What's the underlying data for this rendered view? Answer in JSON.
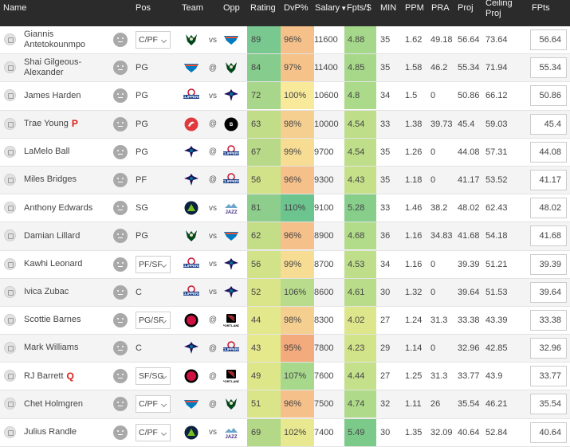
{
  "header": {
    "name": "Name",
    "pos": "Pos",
    "team": "Team",
    "opp": "Opp",
    "rating": "Rating",
    "dvp": "DvP%",
    "salary": "Salary",
    "fpts_per": "Fpts/$",
    "min": "MIN",
    "ppm": "PPM",
    "pra": "PRA",
    "proj": "Proj",
    "ceiling": "Ceiling Proj",
    "fpts": "FPts"
  },
  "teams": {
    "MIL": {
      "icon": "bucks-logo-icon",
      "color": "#00471B",
      "text": ""
    },
    "OKC": {
      "icon": "thunder-logo-icon",
      "color": "#007AC1",
      "text": ""
    },
    "LAC": {
      "icon": "clippers-logo-icon",
      "color": "#C8102E",
      "text": "CLIPPERS"
    },
    "CHA": {
      "icon": "hornets-logo-icon",
      "color": "#1D1160",
      "text": ""
    },
    "BKN": {
      "icon": "nets-logo-icon",
      "color": "#000000",
      "text": "BROOKLYN"
    },
    "ATL": {
      "icon": "hawks-logo-icon",
      "color": "#E03A3E",
      "text": ""
    },
    "MIN": {
      "icon": "timberwolves-logo-icon",
      "color": "#0C2340",
      "text": ""
    },
    "UTA": {
      "icon": "jazz-logo-icon",
      "color": "#3E2680",
      "text": "JAZZ"
    },
    "TOR": {
      "icon": "raptors-logo-icon",
      "color": "#CE1141",
      "text": ""
    },
    "POR": {
      "icon": "blazers-logo-icon",
      "color": "#E03A3E",
      "text": "PORTLAND"
    }
  },
  "players": [
    {
      "name": "Giannis Antetokounmpo",
      "tag": "",
      "pos": "C/PF",
      "pos_select": true,
      "team": "MIL",
      "ha": "vs",
      "opp": "OKC",
      "rating": "89",
      "dvp": "96%",
      "salary": "11600",
      "fpts_per": "4.88",
      "min": "35",
      "ppm": "1.62",
      "pra": "49.18",
      "proj": "56.64",
      "ceil": "73.64",
      "fpts": "56.64",
      "rating_color": "#78c890",
      "dvp_color": "#f5c08a",
      "fpts_color": "#a5d88a"
    },
    {
      "name": "Shai Gilgeous-Alexander",
      "tag": "",
      "pos": "PG",
      "pos_select": false,
      "team": "OKC",
      "ha": "@",
      "opp": "MIL",
      "rating": "84",
      "dvp": "97%",
      "salary": "11400",
      "fpts_per": "4.85",
      "min": "35",
      "ppm": "1.58",
      "pra": "46.2",
      "proj": "55.34",
      "ceil": "71.94",
      "fpts": "55.34",
      "rating_color": "#86cc8c",
      "dvp_color": "#f5c38a",
      "fpts_color": "#a7d88a"
    },
    {
      "name": "James Harden",
      "tag": "",
      "pos": "PG",
      "pos_select": false,
      "team": "LAC",
      "ha": "vs",
      "opp": "CHA",
      "rating": "72",
      "dvp": "100%",
      "salary": "10600",
      "fpts_per": "4.8",
      "min": "34",
      "ppm": "1.5",
      "pra": "0",
      "proj": "50.86",
      "ceil": "66.12",
      "fpts": "50.86",
      "rating_color": "#a8d68a",
      "dvp_color": "#f8ea9a",
      "fpts_color": "#aada8a"
    },
    {
      "name": "Trae Young",
      "tag": "P",
      "pos": "PG",
      "pos_select": false,
      "team": "ATL",
      "ha": "@",
      "opp": "BKN",
      "rating": "63",
      "dvp": "98%",
      "salary": "10000",
      "fpts_per": "4.54",
      "min": "33",
      "ppm": "1.38",
      "pra": "39.73",
      "proj": "45.4",
      "ceil": "59.03",
      "fpts": "45.4",
      "rating_color": "#c2dd88",
      "dvp_color": "#f5cf90",
      "fpts_color": "#bede8a"
    },
    {
      "name": "LaMelo Ball",
      "tag": "",
      "pos": "PG",
      "pos_select": false,
      "team": "CHA",
      "ha": "@",
      "opp": "LAC",
      "rating": "67",
      "dvp": "99%",
      "salary": "9700",
      "fpts_per": "4.54",
      "min": "35",
      "ppm": "1.26",
      "pra": "0",
      "proj": "44.08",
      "ceil": "57.31",
      "fpts": "44.08",
      "rating_color": "#b8da88",
      "dvp_color": "#f7dc94",
      "fpts_color": "#bede8a"
    },
    {
      "name": "Miles Bridges",
      "tag": "",
      "pos": "PF",
      "pos_select": false,
      "team": "CHA",
      "ha": "@",
      "opp": "LAC",
      "rating": "56",
      "dvp": "96%",
      "salary": "9300",
      "fpts_per": "4.43",
      "min": "35",
      "ppm": "1.18",
      "pra": "0",
      "proj": "41.17",
      "ceil": "53.52",
      "fpts": "41.17",
      "rating_color": "#d2e288",
      "dvp_color": "#f5c08a",
      "fpts_color": "#c6e08a"
    },
    {
      "name": "Anthony Edwards",
      "tag": "",
      "pos": "SG",
      "pos_select": false,
      "team": "MIN",
      "ha": "vs",
      "opp": "UTA",
      "rating": "81",
      "dvp": "110%",
      "salary": "9100",
      "fpts_per": "5.28",
      "min": "33",
      "ppm": "1.46",
      "pra": "38.2",
      "proj": "48.02",
      "ceil": "62.43",
      "fpts": "48.02",
      "rating_color": "#8ece8c",
      "dvp_color": "#6cc48e",
      "fpts_color": "#86ce8a"
    },
    {
      "name": "Damian Lillard",
      "tag": "",
      "pos": "PG",
      "pos_select": false,
      "team": "MIL",
      "ha": "vs",
      "opp": "OKC",
      "rating": "62",
      "dvp": "96%",
      "salary": "8900",
      "fpts_per": "4.68",
      "min": "36",
      "ppm": "1.16",
      "pra": "34.83",
      "proj": "41.68",
      "ceil": "54.18",
      "fpts": "41.68",
      "rating_color": "#c4de88",
      "dvp_color": "#f5c08a",
      "fpts_color": "#b2dc8a"
    },
    {
      "name": "Kawhi Leonard",
      "tag": "",
      "pos": "PF/SF",
      "pos_select": true,
      "team": "LAC",
      "ha": "vs",
      "opp": "CHA",
      "rating": "56",
      "dvp": "99%",
      "salary": "8700",
      "fpts_per": "4.53",
      "min": "34",
      "ppm": "1.16",
      "pra": "0",
      "proj": "39.39",
      "ceil": "51.21",
      "fpts": "39.39",
      "rating_color": "#d2e288",
      "dvp_color": "#f7dc94",
      "fpts_color": "#bede8a"
    },
    {
      "name": "Ivica Zubac",
      "tag": "",
      "pos": "C",
      "pos_select": false,
      "team": "LAC",
      "ha": "vs",
      "opp": "CHA",
      "rating": "52",
      "dvp": "106%",
      "salary": "8600",
      "fpts_per": "4.61",
      "min": "30",
      "ppm": "1.32",
      "pra": "0",
      "proj": "39.64",
      "ceil": "51.53",
      "fpts": "39.64",
      "rating_color": "#dae488",
      "dvp_color": "#b8dc8c",
      "fpts_color": "#b8dc8a"
    },
    {
      "name": "Scottie Barnes",
      "tag": "",
      "pos": "PG/SF",
      "pos_select": true,
      "team": "TOR",
      "ha": "@",
      "opp": "POR",
      "rating": "44",
      "dvp": "98%",
      "salary": "8300",
      "fpts_per": "4.02",
      "min": "27",
      "ppm": "1.24",
      "pra": "31.3",
      "proj": "33.38",
      "ceil": "43.39",
      "fpts": "33.38",
      "rating_color": "#e4e88c",
      "dvp_color": "#f5cf90",
      "fpts_color": "#dde68a"
    },
    {
      "name": "Mark Williams",
      "tag": "",
      "pos": "C",
      "pos_select": false,
      "team": "CHA",
      "ha": "@",
      "opp": "LAC",
      "rating": "43",
      "dvp": "95%",
      "salary": "7800",
      "fpts_per": "4.23",
      "min": "29",
      "ppm": "1.14",
      "pra": "0",
      "proj": "32.96",
      "ceil": "42.85",
      "fpts": "32.96",
      "rating_color": "#e6e88c",
      "dvp_color": "#f3aa7c",
      "fpts_color": "#d2e48a"
    },
    {
      "name": "RJ Barrett",
      "tag": "Q",
      "pos": "SF/SG",
      "pos_select": true,
      "team": "TOR",
      "ha": "@",
      "opp": "POR",
      "rating": "49",
      "dvp": "107%",
      "salary": "7600",
      "fpts_per": "4.44",
      "min": "27",
      "ppm": "1.25",
      "pra": "31.3",
      "proj": "33.77",
      "ceil": "43.9",
      "fpts": "33.77",
      "rating_color": "#dee68a",
      "dvp_color": "#a8d88c",
      "fpts_color": "#c4e08a"
    },
    {
      "name": "Chet Holmgren",
      "tag": "",
      "pos": "C/PF",
      "pos_select": true,
      "team": "OKC",
      "ha": "@",
      "opp": "MIL",
      "rating": "51",
      "dvp": "96%",
      "salary": "7500",
      "fpts_per": "4.74",
      "min": "32",
      "ppm": "1.11",
      "pra": "26",
      "proj": "35.54",
      "ceil": "46.21",
      "fpts": "35.54",
      "rating_color": "#dae488",
      "dvp_color": "#f5c08a",
      "fpts_color": "#aeda8a"
    },
    {
      "name": "Julius Randle",
      "tag": "",
      "pos": "C/PF",
      "pos_select": true,
      "team": "MIN",
      "ha": "vs",
      "opp": "UTA",
      "rating": "69",
      "dvp": "102%",
      "salary": "7400",
      "fpts_per": "5.49",
      "min": "30",
      "ppm": "1.35",
      "pra": "32.09",
      "proj": "40.64",
      "ceil": "52.84",
      "fpts": "40.64",
      "rating_color": "#b2d888",
      "dvp_color": "#e8e890",
      "fpts_color": "#7cca8a"
    }
  ]
}
